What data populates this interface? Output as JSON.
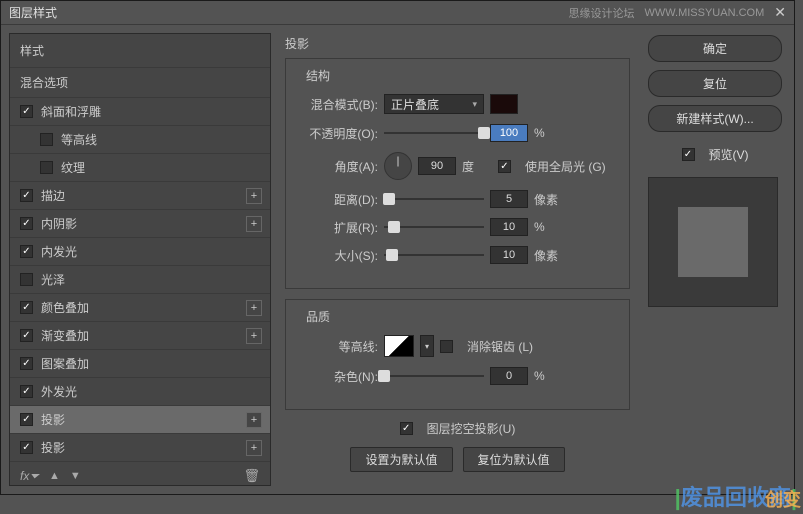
{
  "titlebar": {
    "title": "图层样式",
    "forum": "思缘设计论坛",
    "url": "WWW.MISSYUAN.COM"
  },
  "left": {
    "styles_header": "样式",
    "blend_header": "混合选项",
    "items": [
      {
        "label": "斜面和浮雕",
        "checked": true,
        "plus": false,
        "indent": false
      },
      {
        "label": "等高线",
        "checked": false,
        "plus": false,
        "indent": true
      },
      {
        "label": "纹理",
        "checked": false,
        "plus": false,
        "indent": true
      },
      {
        "label": "描边",
        "checked": true,
        "plus": true,
        "indent": false
      },
      {
        "label": "内阴影",
        "checked": true,
        "plus": true,
        "indent": false
      },
      {
        "label": "内发光",
        "checked": true,
        "plus": false,
        "indent": false
      },
      {
        "label": "光泽",
        "checked": false,
        "plus": false,
        "indent": false
      },
      {
        "label": "颜色叠加",
        "checked": true,
        "plus": true,
        "indent": false
      },
      {
        "label": "渐变叠加",
        "checked": true,
        "plus": true,
        "indent": false
      },
      {
        "label": "图案叠加",
        "checked": true,
        "plus": false,
        "indent": false
      },
      {
        "label": "外发光",
        "checked": true,
        "plus": false,
        "indent": false
      },
      {
        "label": "投影",
        "checked": true,
        "plus": true,
        "indent": false,
        "selected": true
      },
      {
        "label": "投影",
        "checked": true,
        "plus": true,
        "indent": false
      }
    ]
  },
  "center": {
    "title": "投影",
    "structure": {
      "legend": "结构",
      "blend_mode_label": "混合模式(B):",
      "blend_mode_value": "正片叠底",
      "opacity_label": "不透明度(O):",
      "opacity_value": "100",
      "opacity_unit": "%",
      "angle_label": "角度(A):",
      "angle_value": "90",
      "angle_unit": "度",
      "global_light": "使用全局光 (G)",
      "distance_label": "距离(D):",
      "distance_value": "5",
      "distance_unit": "像素",
      "spread_label": "扩展(R):",
      "spread_value": "10",
      "spread_unit": "%",
      "size_label": "大小(S):",
      "size_value": "10",
      "size_unit": "像素"
    },
    "quality": {
      "legend": "品质",
      "contour_label": "等高线:",
      "antialias": "消除锯齿 (L)",
      "noise_label": "杂色(N):",
      "noise_value": "0",
      "noise_unit": "%"
    },
    "knockout": "图层挖空投影(U)",
    "set_default": "设置为默认值",
    "reset_default": "复位为默认值"
  },
  "right": {
    "ok": "确定",
    "cancel": "复位",
    "new_style": "新建样式(W)...",
    "preview": "预览(V)"
  },
  "watermark": {
    "text1": "废品回收商",
    "text2": "创变"
  }
}
